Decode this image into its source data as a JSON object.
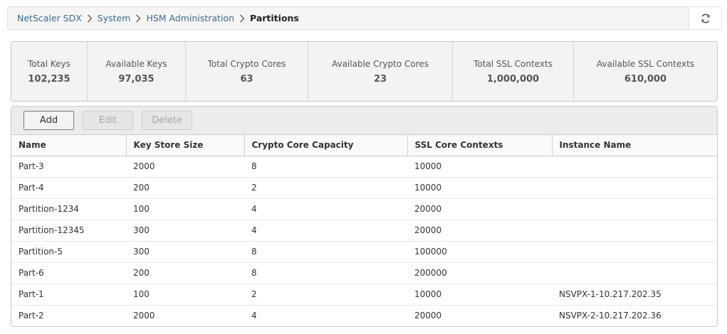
{
  "breadcrumb": {
    "items": [
      "NetScaler SDX",
      "System",
      "HSM Administration"
    ],
    "current": "Partitions"
  },
  "icons": {
    "separator": "chevron-right-icon",
    "refresh": "refresh-icon"
  },
  "stats": [
    {
      "label": "Total Keys",
      "value": "102,235"
    },
    {
      "label": "Available Keys",
      "value": "97,035"
    },
    {
      "label": "Total Crypto Cores",
      "value": "63"
    },
    {
      "label": "Available Crypto Cores",
      "value": "23"
    },
    {
      "label": "Total SSL Contexts",
      "value": "1,000,000"
    },
    {
      "label": "Available SSL Contexts",
      "value": "610,000"
    }
  ],
  "toolbar": {
    "add_label": "Add",
    "edit_label": "Edit",
    "delete_label": "Delete"
  },
  "table": {
    "columns": [
      "Name",
      "Key Store Size",
      "Crypto Core Capacity",
      "SSL Core Contexts",
      "Instance Name"
    ],
    "rows": [
      [
        "Part-3",
        "2000",
        "8",
        "10000",
        ""
      ],
      [
        "Part-4",
        "200",
        "2",
        "10000",
        ""
      ],
      [
        "Partition-1234",
        "100",
        "4",
        "20000",
        ""
      ],
      [
        "Partition-12345",
        "300",
        "4",
        "20000",
        ""
      ],
      [
        "Partition-5",
        "300",
        "8",
        "100000",
        ""
      ],
      [
        "Part-6",
        "200",
        "8",
        "200000",
        ""
      ],
      [
        "Part-1",
        "100",
        "2",
        "10000",
        "NSVPX-1-10.217.202.35"
      ],
      [
        "Part-2",
        "2000",
        "4",
        "20000",
        "NSVPX-2-10.217.202.36"
      ]
    ]
  }
}
